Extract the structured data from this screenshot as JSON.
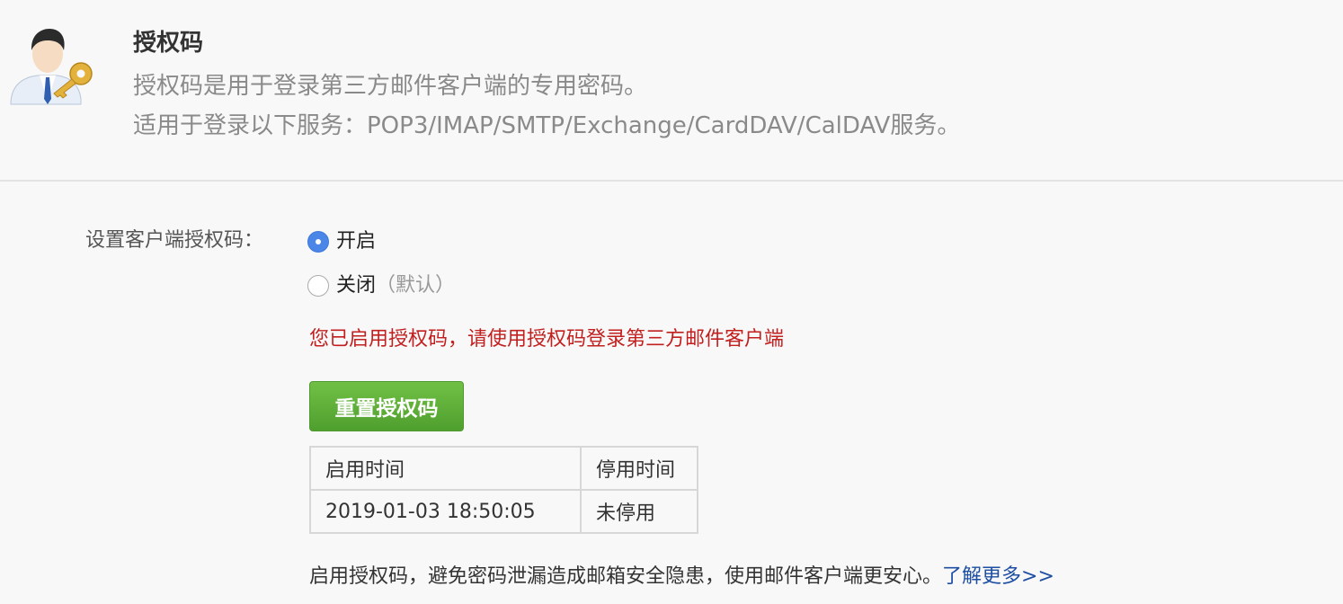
{
  "header": {
    "title": "授权码",
    "description_1": "授权码是用于登录第三方邮件客户端的专用密码。",
    "description_2": "适用于登录以下服务：POP3/IMAP/SMTP/Exchange/CardDAV/CalDAV服务。",
    "avatar_icon": "user-key-icon"
  },
  "setting": {
    "label": "设置客户端授权码：",
    "options": [
      {
        "label": "开启",
        "note": "",
        "checked": true
      },
      {
        "label": "关闭",
        "note": "（默认）",
        "checked": false
      }
    ]
  },
  "notice": "您已启用授权码，请使用授权码登录第三方邮件客户端",
  "reset_button": "重置授权码",
  "table": {
    "headers": [
      "启用时间",
      "停用时间"
    ],
    "rows": [
      [
        "2019-01-03 18:50:05",
        "未停用"
      ]
    ]
  },
  "footer": {
    "text": "启用授权码，避免密码泄漏造成邮箱安全隐患，使用邮件客户端更安心。",
    "link": "了解更多>>"
  },
  "colors": {
    "notice": "#c21f1f",
    "button": "#5aab36",
    "link": "#1e4fa3",
    "radio_checked": "#4a86e8"
  }
}
